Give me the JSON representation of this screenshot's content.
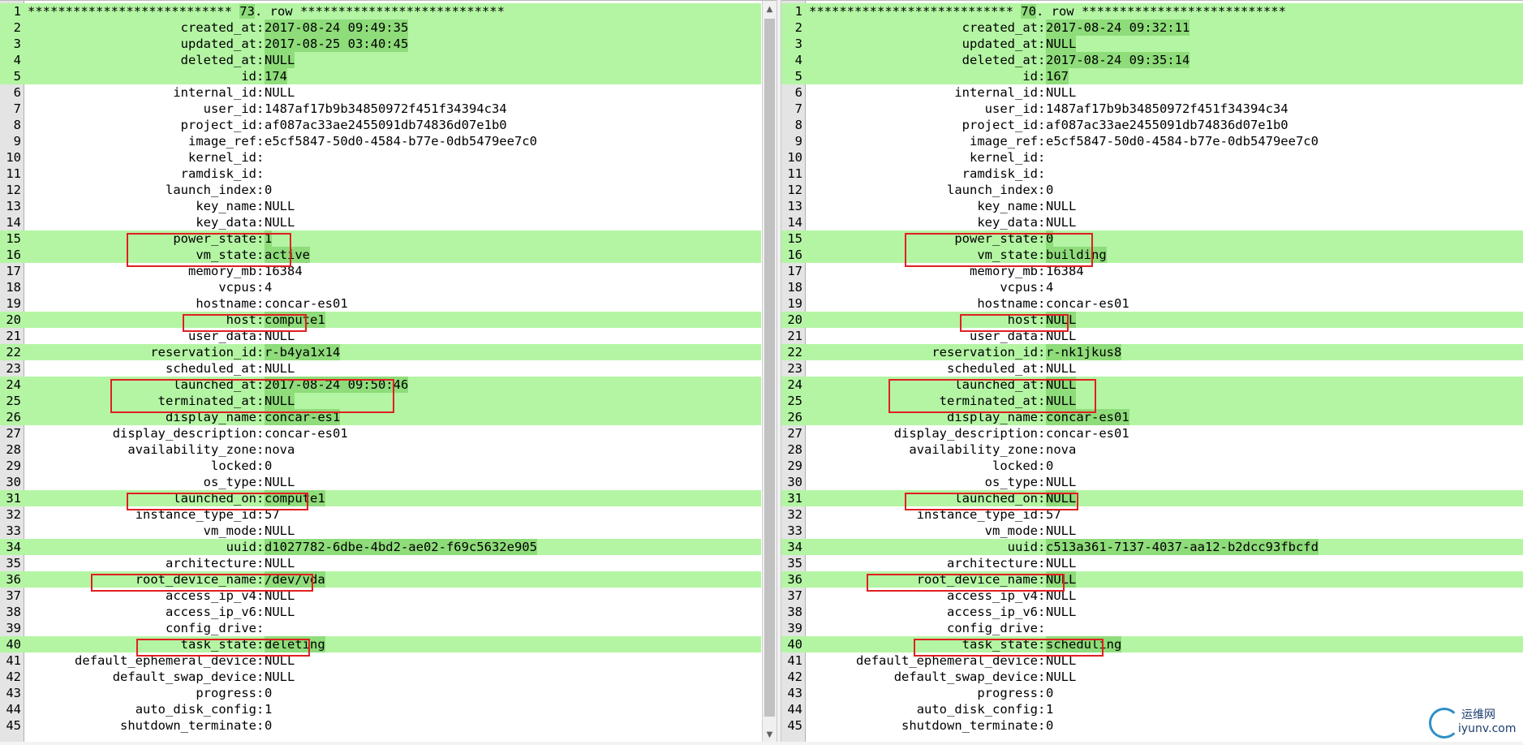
{
  "left": {
    "header_prefix": "*************************** ",
    "header_num": "73",
    "header_suffix": ". row ***************************",
    "rows": [
      {
        "f": "created_at",
        "v": "2017-08-24 09:49:35",
        "d": true
      },
      {
        "f": "updated_at",
        "v": "2017-08-25 03:40:45",
        "d": true
      },
      {
        "f": "deleted_at",
        "v": "NULL",
        "d": true
      },
      {
        "f": "id",
        "v": "174",
        "d": true
      },
      {
        "f": "internal_id",
        "v": "NULL",
        "d": false
      },
      {
        "f": "user_id",
        "v": "1487af17b9b34850972f451f34394c34",
        "d": false
      },
      {
        "f": "project_id",
        "v": "af087ac33ae2455091db74836d07e1b0",
        "d": false
      },
      {
        "f": "image_ref",
        "v": "e5cf5847-50d0-4584-b77e-0db5479ee7c0",
        "d": false
      },
      {
        "f": "kernel_id",
        "v": "",
        "d": false
      },
      {
        "f": "ramdisk_id",
        "v": "",
        "d": false
      },
      {
        "f": "launch_index",
        "v": "0",
        "d": false
      },
      {
        "f": "key_name",
        "v": "NULL",
        "d": false
      },
      {
        "f": "key_data",
        "v": "NULL",
        "d": false
      },
      {
        "f": "power_state",
        "v": "1",
        "d": true
      },
      {
        "f": "vm_state",
        "v": "active",
        "d": true
      },
      {
        "f": "memory_mb",
        "v": "16384",
        "d": false
      },
      {
        "f": "vcpus",
        "v": "4",
        "d": false
      },
      {
        "f": "hostname",
        "v": "concar-es01",
        "d": false
      },
      {
        "f": "host",
        "v": "compute1",
        "d": true
      },
      {
        "f": "user_data",
        "v": "NULL",
        "d": false
      },
      {
        "f": "reservation_id",
        "v": "r-b4ya1x14",
        "d": true
      },
      {
        "f": "scheduled_at",
        "v": "NULL",
        "d": false
      },
      {
        "f": "launched_at",
        "v": "2017-08-24 09:50:46",
        "d": true
      },
      {
        "f": "terminated_at",
        "v": "NULL",
        "d": true
      },
      {
        "f": "display_name",
        "v": "concar-es1",
        "d": true
      },
      {
        "f": "display_description",
        "v": "concar-es01",
        "d": false
      },
      {
        "f": "availability_zone",
        "v": "nova",
        "d": false
      },
      {
        "f": "locked",
        "v": "0",
        "d": false
      },
      {
        "f": "os_type",
        "v": "NULL",
        "d": false
      },
      {
        "f": "launched_on",
        "v": "compute1",
        "d": true
      },
      {
        "f": "instance_type_id",
        "v": "57",
        "d": false
      },
      {
        "f": "vm_mode",
        "v": "NULL",
        "d": false
      },
      {
        "f": "uuid",
        "v": "d1027782-6dbe-4bd2-ae02-f69c5632e905",
        "d": true
      },
      {
        "f": "architecture",
        "v": "NULL",
        "d": false
      },
      {
        "f": "root_device_name",
        "v": "/dev/vda",
        "d": true
      },
      {
        "f": "access_ip_v4",
        "v": "NULL",
        "d": false
      },
      {
        "f": "access_ip_v6",
        "v": "NULL",
        "d": false
      },
      {
        "f": "config_drive",
        "v": "",
        "d": false
      },
      {
        "f": "task_state",
        "v": "deleting",
        "d": true
      },
      {
        "f": "default_ephemeral_device",
        "v": "NULL",
        "d": false
      },
      {
        "f": "default_swap_device",
        "v": "NULL",
        "d": false
      },
      {
        "f": "progress",
        "v": "0",
        "d": false
      },
      {
        "f": "auto_disk_config",
        "v": "1",
        "d": false
      },
      {
        "f": "shutdown_terminate",
        "v": "0",
        "d": false
      }
    ]
  },
  "right": {
    "header_prefix": "*************************** ",
    "header_num": "70",
    "header_suffix": ". row ***************************",
    "rows": [
      {
        "f": "created_at",
        "v": "2017-08-24 09:32:11",
        "d": true
      },
      {
        "f": "updated_at",
        "v": "NULL",
        "d": true
      },
      {
        "f": "deleted_at",
        "v": "2017-08-24 09:35:14",
        "d": true
      },
      {
        "f": "id",
        "v": "167",
        "d": true
      },
      {
        "f": "internal_id",
        "v": "NULL",
        "d": false
      },
      {
        "f": "user_id",
        "v": "1487af17b9b34850972f451f34394c34",
        "d": false
      },
      {
        "f": "project_id",
        "v": "af087ac33ae2455091db74836d07e1b0",
        "d": false
      },
      {
        "f": "image_ref",
        "v": "e5cf5847-50d0-4584-b77e-0db5479ee7c0",
        "d": false
      },
      {
        "f": "kernel_id",
        "v": "",
        "d": false
      },
      {
        "f": "ramdisk_id",
        "v": "",
        "d": false
      },
      {
        "f": "launch_index",
        "v": "0",
        "d": false
      },
      {
        "f": "key_name",
        "v": "NULL",
        "d": false
      },
      {
        "f": "key_data",
        "v": "NULL",
        "d": false
      },
      {
        "f": "power_state",
        "v": "0",
        "d": true
      },
      {
        "f": "vm_state",
        "v": "building",
        "d": true
      },
      {
        "f": "memory_mb",
        "v": "16384",
        "d": false
      },
      {
        "f": "vcpus",
        "v": "4",
        "d": false
      },
      {
        "f": "hostname",
        "v": "concar-es01",
        "d": false
      },
      {
        "f": "host",
        "v": "NULL",
        "d": true
      },
      {
        "f": "user_data",
        "v": "NULL",
        "d": false
      },
      {
        "f": "reservation_id",
        "v": "r-nk1jkus8",
        "d": true
      },
      {
        "f": "scheduled_at",
        "v": "NULL",
        "d": false
      },
      {
        "f": "launched_at",
        "v": "NULL",
        "d": true
      },
      {
        "f": "terminated_at",
        "v": "NULL",
        "d": true
      },
      {
        "f": "display_name",
        "v": "concar-es01",
        "d": true
      },
      {
        "f": "display_description",
        "v": "concar-es01",
        "d": false
      },
      {
        "f": "availability_zone",
        "v": "nova",
        "d": false
      },
      {
        "f": "locked",
        "v": "0",
        "d": false
      },
      {
        "f": "os_type",
        "v": "NULL",
        "d": false
      },
      {
        "f": "launched_on",
        "v": "NULL",
        "d": true
      },
      {
        "f": "instance_type_id",
        "v": "57",
        "d": false
      },
      {
        "f": "vm_mode",
        "v": "NULL",
        "d": false
      },
      {
        "f": "uuid",
        "v": "c513a361-7137-4037-aa12-b2dcc93fbcfd",
        "d": true
      },
      {
        "f": "architecture",
        "v": "NULL",
        "d": false
      },
      {
        "f": "root_device_name",
        "v": "NULL",
        "d": true
      },
      {
        "f": "access_ip_v4",
        "v": "NULL",
        "d": false
      },
      {
        "f": "access_ip_v6",
        "v": "NULL",
        "d": false
      },
      {
        "f": "config_drive",
        "v": "",
        "d": false
      },
      {
        "f": "task_state",
        "v": "scheduling",
        "d": true
      },
      {
        "f": "default_ephemeral_device",
        "v": "NULL",
        "d": false
      },
      {
        "f": "default_swap_device",
        "v": "NULL",
        "d": false
      },
      {
        "f": "progress",
        "v": "0",
        "d": false
      },
      {
        "f": "auto_disk_config",
        "v": "1",
        "d": false
      },
      {
        "f": "shutdown_terminate",
        "v": "0",
        "d": false
      }
    ]
  },
  "watermark": {
    "line1": "运维网",
    "line2": "iyunv.com"
  },
  "colors": {
    "diff_bg": "#b4f5a4",
    "hl_bg": "#8edc7a",
    "box": "#e02020"
  }
}
